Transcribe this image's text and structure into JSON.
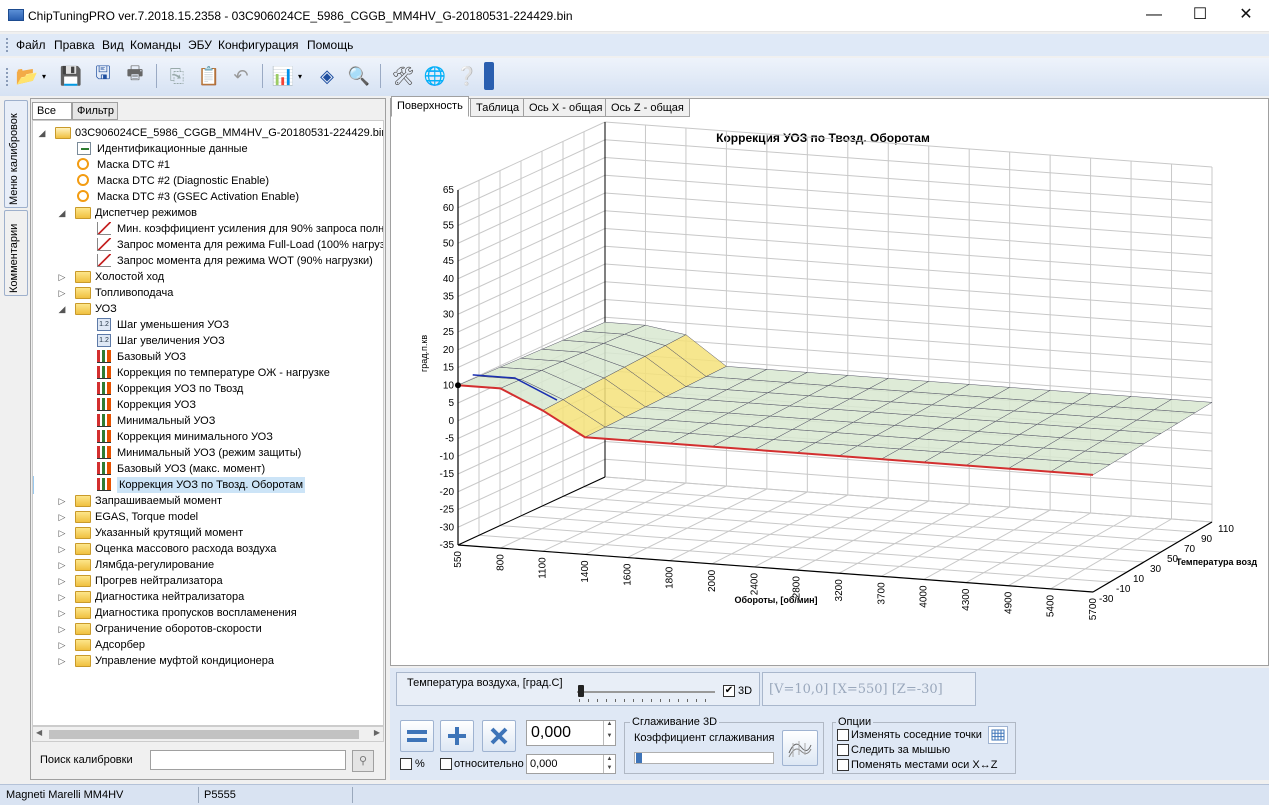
{
  "window": {
    "title": "ChipTuningPRO ver.7.2018.15.2358 - 03C906024CE_5986_CGGB_MM4HV_G-20180531-224429.bin",
    "minimize": "—",
    "maximize": "☐",
    "close": "✕"
  },
  "menu": [
    "Файл",
    "Правка",
    "Вид",
    "Команды",
    "ЭБУ",
    "Конфигурация",
    "Помощь"
  ],
  "side_tabs": [
    "Меню калибровок",
    "Комментарии"
  ],
  "left_tabs": [
    "Все",
    "Фильтр"
  ],
  "tree": {
    "root": "03C906024CE_5986_CGGB_MM4HV_G-20180531-224429.bin",
    "items": [
      {
        "label": "Идентификационные данные",
        "icon": "id-card-icon",
        "level": 2,
        "type": "leaf"
      },
      {
        "label": "Маска DTC #1",
        "icon": "mask-icon",
        "level": 2,
        "type": "leaf"
      },
      {
        "label": "Маска DTC #2 (Diagnostic Enable)",
        "icon": "mask-icon",
        "level": 2,
        "type": "leaf"
      },
      {
        "label": "Маска DTC #3 (GSEC Activation Enable)",
        "icon": "mask-icon",
        "level": 2,
        "type": "leaf"
      },
      {
        "label": "Диспетчер режимов",
        "icon": "folder-icon",
        "level": 1,
        "type": "open"
      },
      {
        "label": "Мин. коэффициент усиления для 90% запроса полн",
        "icon": "curve-icon",
        "level": 3,
        "type": "leaf"
      },
      {
        "label": "Запрос момента для режима Full-Load (100% нагрузк",
        "icon": "curve-icon",
        "level": 3,
        "type": "leaf"
      },
      {
        "label": "Запрос момента для режима WOT (90% нагрузки)",
        "icon": "curve-icon",
        "level": 3,
        "type": "leaf"
      },
      {
        "label": "Холостой ход",
        "icon": "folder-icon",
        "level": 1,
        "type": "closed"
      },
      {
        "label": "Топливоподача",
        "icon": "folder-icon",
        "level": 1,
        "type": "closed"
      },
      {
        "label": "УОЗ",
        "icon": "folder-icon",
        "level": 1,
        "type": "open"
      },
      {
        "label": "Шаг уменьшения УОЗ",
        "icon": "value-icon",
        "level": 3,
        "type": "leaf"
      },
      {
        "label": "Шаг увеличения УОЗ",
        "icon": "value-icon",
        "level": 3,
        "type": "leaf"
      },
      {
        "label": "Базовый УОЗ",
        "icon": "chart-icon",
        "level": 3,
        "type": "leaf"
      },
      {
        "label": "Коррекция по температуре ОЖ - нагрузке",
        "icon": "chart-icon",
        "level": 3,
        "type": "leaf"
      },
      {
        "label": "Коррекция УОЗ по Твозд",
        "icon": "chart-icon",
        "level": 3,
        "type": "leaf"
      },
      {
        "label": "Коррекция УОЗ",
        "icon": "chart-icon",
        "level": 3,
        "type": "leaf"
      },
      {
        "label": "Минимальный УОЗ",
        "icon": "chart-icon",
        "level": 3,
        "type": "leaf"
      },
      {
        "label": "Коррекция минимального УОЗ",
        "icon": "chart-icon",
        "level": 3,
        "type": "leaf"
      },
      {
        "label": "Минимальный УОЗ (режим защиты)",
        "icon": "chart-icon",
        "level": 3,
        "type": "leaf"
      },
      {
        "label": "Базовый УОЗ (макс. момент)",
        "icon": "chart-icon",
        "level": 3,
        "type": "leaf"
      },
      {
        "label": "Коррекция УОЗ по Твозд. Оборотам",
        "icon": "chart-icon",
        "level": 3,
        "type": "leaf",
        "selected": true
      },
      {
        "label": "Запрашиваемый момент",
        "icon": "folder-icon",
        "level": 1,
        "type": "closed"
      },
      {
        "label": "EGAS, Torque model",
        "icon": "folder-icon",
        "level": 1,
        "type": "closed"
      },
      {
        "label": "Указанный крутящий момент",
        "icon": "folder-icon",
        "level": 1,
        "type": "closed"
      },
      {
        "label": "Оценка массового расхода воздуха",
        "icon": "folder-icon",
        "level": 1,
        "type": "closed"
      },
      {
        "label": "Лямбда-регулирование",
        "icon": "folder-icon",
        "level": 1,
        "type": "closed"
      },
      {
        "label": "Прогрев нейтрализатора",
        "icon": "folder-icon",
        "level": 1,
        "type": "closed"
      },
      {
        "label": "Диагностика нейтрализатора",
        "icon": "folder-icon",
        "level": 1,
        "type": "closed"
      },
      {
        "label": "Диагностика пропусков воспламенения",
        "icon": "folder-icon",
        "level": 1,
        "type": "closed"
      },
      {
        "label": "Ограничение оборотов-скорости",
        "icon": "folder-icon",
        "level": 1,
        "type": "closed"
      },
      {
        "label": "Адсорбер",
        "icon": "folder-icon",
        "level": 1,
        "type": "closed"
      },
      {
        "label": "Управление муфтой кондиционера",
        "icon": "folder-icon",
        "level": 1,
        "type": "closed"
      }
    ]
  },
  "search": {
    "label": "Поиск калибровки",
    "value": ""
  },
  "view_tabs": [
    "Поверхность",
    "Таблица",
    "Ось X - общая",
    "Ось Z - общая"
  ],
  "chart_data": {
    "type": "surface3d",
    "title": "Коррекция УОЗ по Твозд. Оборотам",
    "ylabel": "град.п.кв",
    "xlabel": "Обороты, [об/мин]",
    "zlabel": "Температура возд",
    "y_ticks": [
      65,
      60,
      55,
      50,
      45,
      40,
      35,
      30,
      25,
      20,
      15,
      10,
      5,
      0,
      -5,
      -10,
      -15,
      -20,
      -25,
      -30,
      -35
    ],
    "x_ticks": [
      550,
      800,
      1100,
      1400,
      1600,
      1800,
      2000,
      2400,
      2800,
      3200,
      3700,
      4000,
      4300,
      4900,
      5400,
      5700
    ],
    "z_ticks": [
      -30,
      -10,
      10,
      30,
      50,
      70,
      90,
      110
    ],
    "ylim": [
      -35,
      65
    ],
    "colors": {
      "surface": "#d8e8d0",
      "front_edge": "#d32f2f",
      "back_edge": "#1a2fb0",
      "ramp": "#f5e27a"
    }
  },
  "air_temp": {
    "label": "Температура воздуха, [град.С]",
    "checkbox_3d": "3D",
    "checked_3d": true,
    "slider_fraction": 0.0
  },
  "readout": "[V=10,0] [X=550] [Z=-30]",
  "controls": {
    "value1": "0,000",
    "percent_label": "%",
    "relative_label": "относительно",
    "value2": "0,000",
    "smoothing_title": "Сглаживание 3D",
    "smoothing_label": "Коэффициент сглаживания",
    "smoothing_fraction": 0.0,
    "options_title": "Опции",
    "options": [
      "Изменять соседние точки",
      "Следить за мышью",
      "Поменять местами оси X↔Z"
    ]
  },
  "status": {
    "ecu": "Magneti Marelli MM4HV",
    "code": "P5555"
  }
}
